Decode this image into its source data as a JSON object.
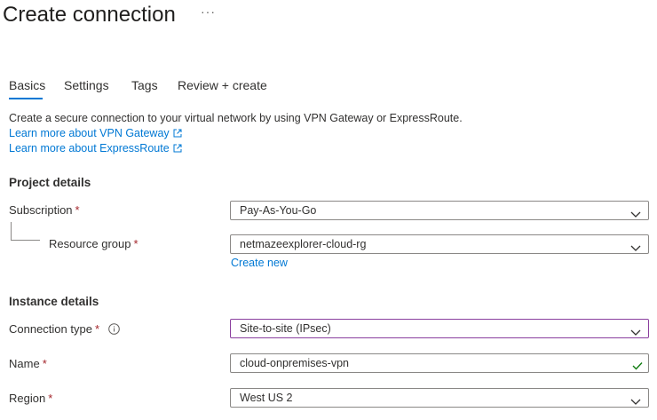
{
  "page": {
    "title": "Create connection",
    "more_label": "···"
  },
  "tabs": [
    {
      "label": "Basics",
      "active": true
    },
    {
      "label": "Settings",
      "active": false
    },
    {
      "label": "Tags",
      "active": false
    },
    {
      "label": "Review + create",
      "active": false
    }
  ],
  "intro": {
    "description": "Create a secure connection to your virtual network by using VPN Gateway or ExpressRoute.",
    "link_vpn": "Learn more about VPN Gateway",
    "link_expressroute": "Learn more about ExpressRoute"
  },
  "project_details": {
    "heading": "Project details",
    "subscription": {
      "label": "Subscription",
      "required": "*",
      "value": "Pay-As-You-Go"
    },
    "resource_group": {
      "label": "Resource group",
      "required": "*",
      "value": "netmazeexplorer-cloud-rg",
      "create_new": "Create new"
    }
  },
  "instance_details": {
    "heading": "Instance details",
    "connection_type": {
      "label": "Connection type",
      "required": "*",
      "value": "Site-to-site (IPsec)"
    },
    "name": {
      "label": "Name",
      "required": "*",
      "value": "cloud-onpremises-vpn"
    },
    "region": {
      "label": "Region",
      "required": "*",
      "value": "West US 2"
    }
  },
  "colors": {
    "accent": "#0078d4",
    "required": "#a4262c",
    "focus_border": "#8a3f9e",
    "valid_check": "#107c10"
  }
}
